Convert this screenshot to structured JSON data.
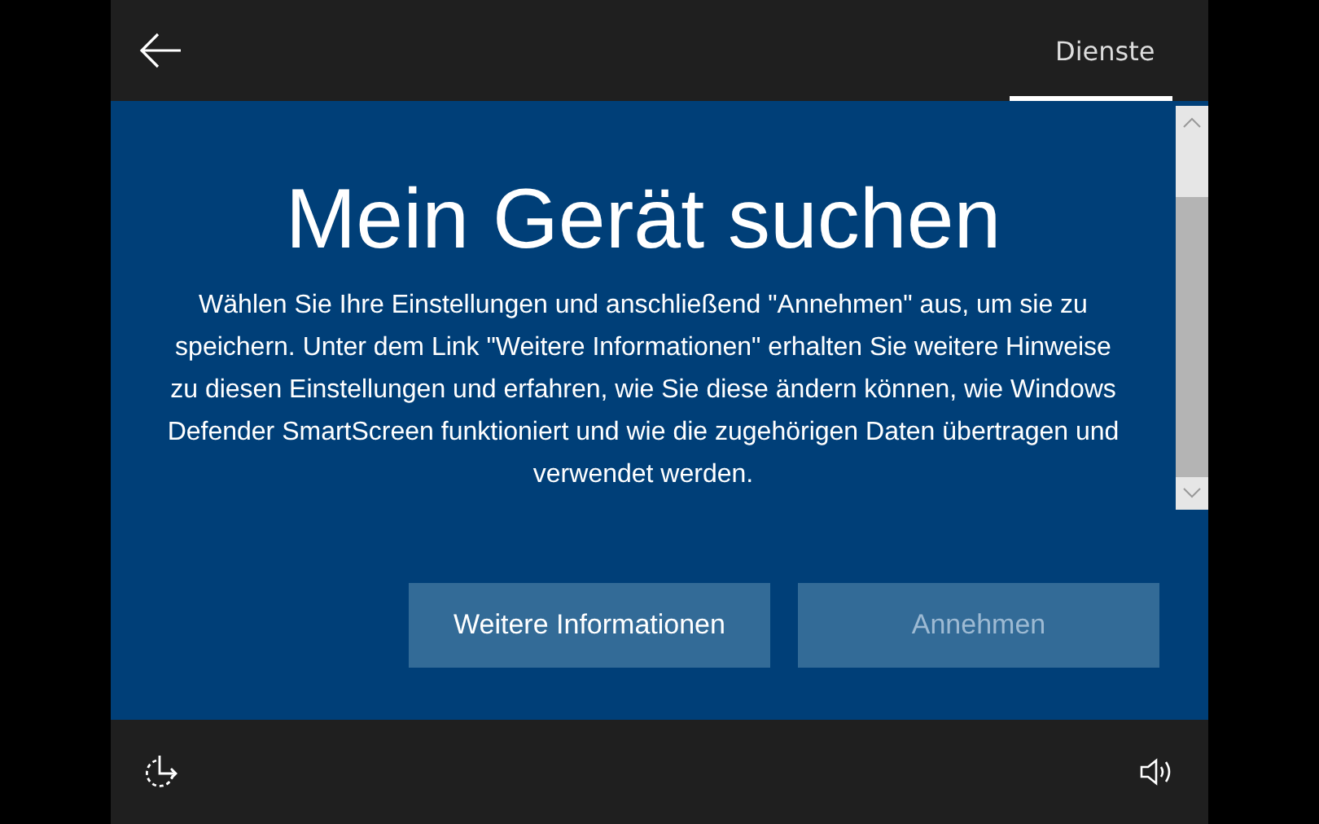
{
  "header": {
    "tabs": [
      {
        "label": "Dienste",
        "selected": true
      }
    ]
  },
  "content": {
    "title": "Mein Gerät suchen",
    "description": "Wählen Sie Ihre Einstellungen und anschließend \"Annehmen\" aus, um sie zu speichern. Unter dem Link \"Weitere Informationen\" erhalten Sie weitere Hinweise zu diesen Einstellungen und erfahren, wie Sie diese ändern können, wie Windows Defender SmartScreen funktioniert und wie die zugehörigen Daten übertragen und verwendet werden."
  },
  "buttons": [
    {
      "label": "Weitere Informationen",
      "disabled": false
    },
    {
      "label": "Annehmen",
      "disabled": true
    }
  ]
}
